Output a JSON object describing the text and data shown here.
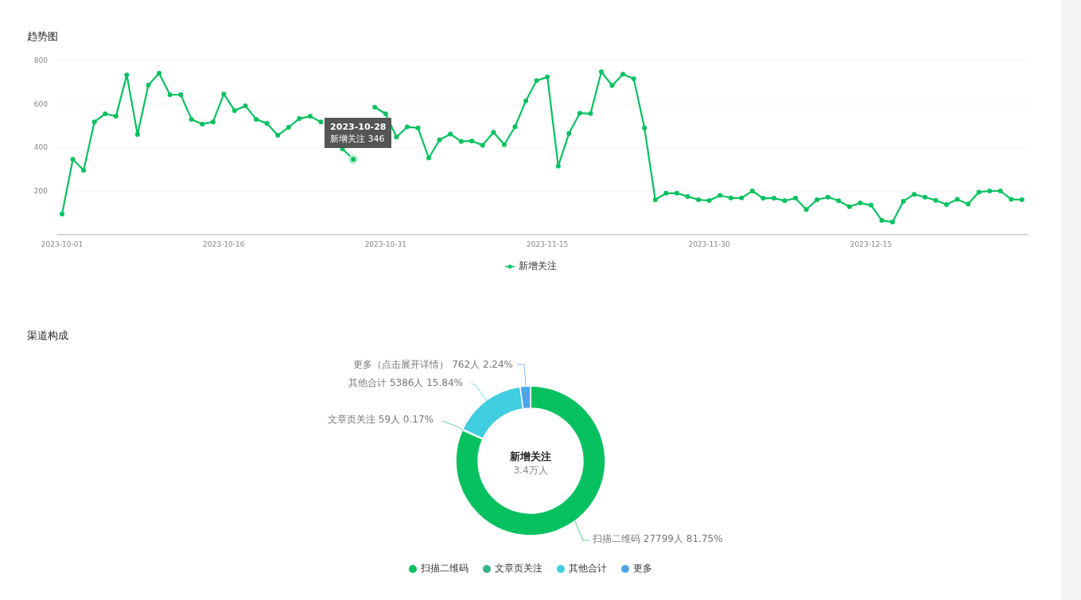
{
  "trend": {
    "title": "趋势图",
    "chart_data": {
      "type": "line",
      "grid": true,
      "categories": [
        "2023-10-01",
        null,
        null,
        null,
        null,
        null,
        null,
        null,
        null,
        null,
        null,
        null,
        null,
        null,
        null,
        "2023-10-16",
        null,
        null,
        null,
        null,
        null,
        null,
        null,
        null,
        null,
        null,
        null,
        null,
        null,
        null,
        "2023-10-31",
        null,
        null,
        null,
        null,
        null,
        null,
        null,
        null,
        null,
        null,
        null,
        null,
        null,
        null,
        "2023-11-15",
        null,
        null,
        null,
        null,
        null,
        null,
        null,
        null,
        null,
        null,
        null,
        null,
        null,
        null,
        "2023-11-30",
        null,
        null,
        null,
        null,
        null,
        null,
        null,
        null,
        null,
        null,
        null,
        null,
        null,
        null,
        "2023-12-15",
        null,
        null,
        null,
        null,
        null,
        null,
        null,
        null,
        null,
        null,
        null,
        null,
        null,
        null
      ],
      "series": [
        {
          "name": "新增关注",
          "color": "#07c160",
          "marker": "circle",
          "values": [
            94,
            346,
            295,
            518,
            555,
            544,
            734,
            460,
            687,
            742,
            643,
            643,
            530,
            508,
            518,
            646,
            570,
            592,
            530,
            511,
            456,
            493,
            533,
            544,
            518,
            null,
            393,
            346,
            null,
            585,
            555,
            448,
            495,
            490,
            352,
            435,
            462,
            428,
            430,
            411,
            470,
            413,
            496,
            615,
            708,
            724,
            315,
            465,
            558,
            556,
            748,
            685,
            737,
            716,
            490,
            160,
            190,
            190,
            175,
            160,
            156,
            180,
            168,
            168,
            200,
            167,
            167,
            155,
            167,
            115,
            160,
            172,
            155,
            128,
            145,
            135,
            65,
            57,
            153,
            185,
            172,
            157,
            138,
            162,
            140,
            195,
            200,
            200,
            162,
            160
          ]
        }
      ],
      "ylim": [
        0,
        800
      ],
      "yticks": [
        200,
        400,
        600,
        800
      ]
    },
    "tooltip": {
      "date": "2023-10-28",
      "text": "新增关注 346"
    }
  },
  "channel": {
    "title": "渠道构成",
    "chart_data": {
      "type": "donut",
      "categories": [
        "扫描二维码",
        "文章页关注",
        "其他合计",
        "更多"
      ],
      "values": [
        27799,
        59,
        5386,
        762
      ],
      "value_labels": [
        "扫描二维码 27799人 81.75%",
        "文章页关注 59人 0.17%",
        "其他合计 5386人 15.84%",
        "更多（点击展开详情） 762人 2.24%"
      ]
    },
    "center_title": "新增关注",
    "center_value": "3.4万人",
    "legend": [
      {
        "color": "#07c160"
      },
      {
        "color": "#36b38a"
      },
      {
        "color": "#40cde0"
      },
      {
        "color": "#4fa3ea"
      }
    ]
  }
}
